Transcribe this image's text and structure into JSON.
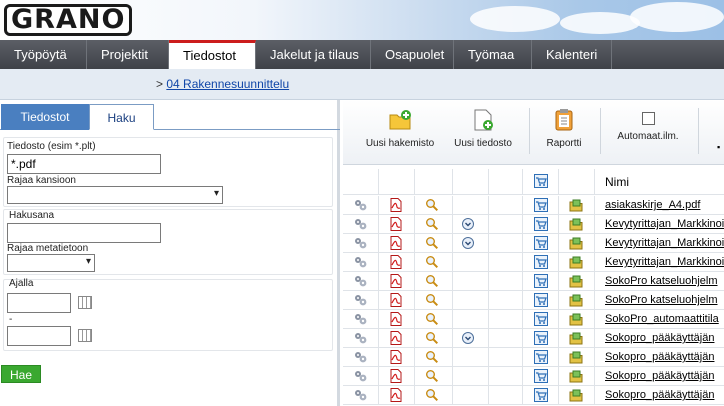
{
  "logo": "GRANO",
  "nav": [
    "Työpöytä",
    "Projektit",
    "Tiedostot",
    "Jakelut ja tilaus",
    "Osapuolet",
    "Työmaa",
    "Kalenteri"
  ],
  "nav_active": 2,
  "breadcrumb": {
    "sep": ">",
    "link": "04 Rakennesuunnittelu"
  },
  "left": {
    "tabs": [
      "Tiedostot",
      "Haku"
    ],
    "file_label": "Tiedosto (esim *.plt)",
    "file_value": "*.pdf",
    "folder_label": "Rajaa kansioon",
    "search_label": "Hakusana",
    "search_value": "",
    "meta_label": "Rajaa metatietoon",
    "period_label": "Ajalla",
    "dash": "-",
    "date_from": "",
    "date_to": "",
    "search_button": "Hae"
  },
  "toolbar": {
    "new_folder": "Uusi hakemisto",
    "new_file": "Uusi tiedosto",
    "report": "Raportti",
    "auto": "Automaat.ilm."
  },
  "grid": {
    "name_header": "Nimi",
    "rows": [
      {
        "name": "asiakaskirje_A4.pdf",
        "expand": false
      },
      {
        "name": "Kevytyrittajan_Markkinoi",
        "expand": true
      },
      {
        "name": "Kevytyrittajan_Markkinoi",
        "expand": true
      },
      {
        "name": "Kevytyrittajan_Markkinoi",
        "expand": false
      },
      {
        "name": "SokoPro katseluohjelm",
        "expand": false
      },
      {
        "name": "SokoPro katseluohjelm",
        "expand": false
      },
      {
        "name": "SokoPro_automaattitila",
        "expand": false
      },
      {
        "name": "Sokopro_pääkäyttäjän",
        "expand": true
      },
      {
        "name": "Sokopro_pääkäyttäjän",
        "expand": false
      },
      {
        "name": "Sokopro_pääkäyttäjän",
        "expand": false
      },
      {
        "name": "Sokopro_pääkäyttäjän",
        "expand": false
      }
    ]
  },
  "colors": {
    "nav_active_border": "#cc1d1d",
    "tab_active": "#4a7fc0",
    "hae_button": "#3aa830",
    "link": "#1046a8"
  }
}
